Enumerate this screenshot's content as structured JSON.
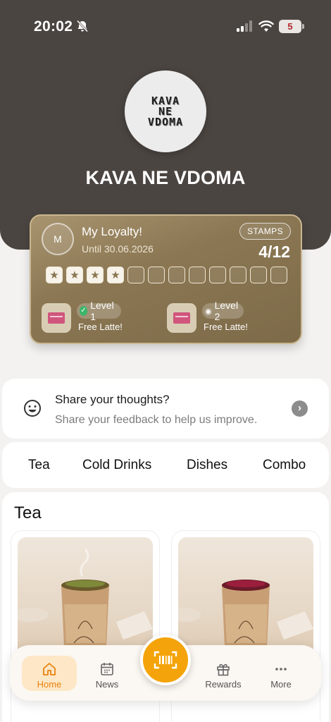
{
  "status_bar": {
    "time": "20:02",
    "battery": "5"
  },
  "brand": {
    "logo_lines": [
      "KAVA",
      "NE",
      "VDOMA"
    ],
    "name": "KAVA NE VDOMA"
  },
  "loyalty": {
    "avatar_initial": "M",
    "title": "My Loyalty!",
    "until": "Until 30.06.2026",
    "stamps_label": "STAMPS",
    "stamps_count": "4/12",
    "stamps_filled": 4,
    "stamps_total": 12,
    "levels": [
      {
        "label": "Level 1",
        "reward": "Free Latte!",
        "status": "achieved"
      },
      {
        "label": "Level 2",
        "reward": "Free Latte!",
        "status": "locked"
      }
    ]
  },
  "feedback": {
    "title": "Share your thoughts?",
    "subtitle": "Share your feedback to help us improve.",
    "icon": "smile-icon"
  },
  "categories": [
    "Tea",
    "Cold Drinks",
    "Dishes",
    "Combo"
  ],
  "section": {
    "title": "Tea"
  },
  "tabbar": {
    "items": [
      {
        "label": "Home",
        "icon": "home-icon",
        "active": true
      },
      {
        "label": "News",
        "icon": "calendar-icon",
        "active": false
      },
      {
        "label": "Rewards",
        "icon": "gift-icon",
        "active": false
      },
      {
        "label": "More",
        "icon": "more-icon",
        "active": false
      }
    ],
    "scan_icon": "barcode-icon"
  },
  "colors": {
    "header": "#4b4541",
    "loyalty_card": "#8b7753",
    "accent": "#f4a40a",
    "active_tab_bg": "#fde7c6",
    "active_tab_text": "#e8830f"
  }
}
